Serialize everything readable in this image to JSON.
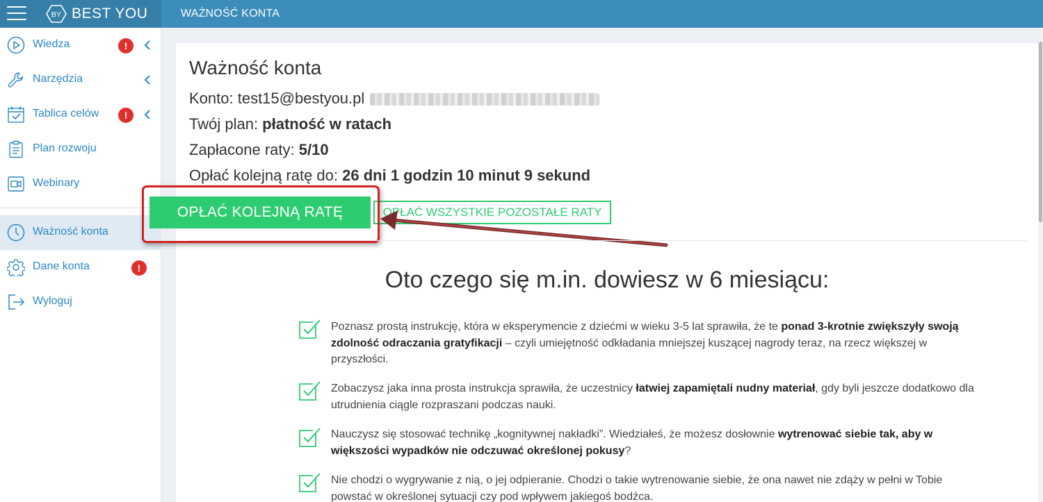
{
  "topbar": {
    "brand": "BEST YOU",
    "brand_mark": "BY",
    "page_header": "WAŻNOŚĆ KONTA"
  },
  "sidebar": {
    "items": [
      {
        "label": "Wiedza",
        "icon": "play-circle-icon",
        "badge": "!",
        "chevron": true
      },
      {
        "label": "Narzędzia",
        "icon": "wrench-icon",
        "chevron": true
      },
      {
        "label": "Tablica celów",
        "icon": "calendar-check-icon",
        "badge": "!",
        "chevron": true
      },
      {
        "label": "Plan rozwoju",
        "icon": "clipboard-icon"
      },
      {
        "label": "Webinary",
        "icon": "video-camera-icon"
      },
      {
        "label": "Ważność konta",
        "icon": "clock-icon",
        "active": true
      },
      {
        "label": "Dane konta",
        "icon": "gear-icon",
        "badge": "!"
      },
      {
        "label": "Wyloguj",
        "icon": "logout-icon"
      }
    ]
  },
  "main": {
    "title": "Ważność konta",
    "account_label": "Konto: ",
    "account_email": "test15@bestyou.pl",
    "plan_label": "Twój plan: ",
    "plan_value": "płatność w ratach",
    "paid_label": "Zapłacone raty: ",
    "paid_value": "5/10",
    "due_label": "Opłać kolejną ratę do: ",
    "due_value": "26 dni 1 godzin 10 minut 9 sekund",
    "btn_pay_next": "OPŁAĆ KOLEJNĄ RATĘ",
    "btn_pay_all": "OPŁAĆ WSZYSTKIE POZOSTAŁE RATY",
    "heading": "Oto czego się m.in. dowiesz w 6 miesiącu:",
    "features": [
      {
        "p1": "Poznasz prostą instrukcję, która w eksperymencie z dziećmi w wieku 3-5 lat sprawiła, że te ",
        "b1": "ponad 3-krotnie zwiększyły swoją zdolność odraczania gratyfikacji",
        "p2": " – czyli umiejętność odkładania mniejszej kuszącej nagrody teraz, na rzecz większej w przyszłości."
      },
      {
        "p1": "Zobaczysz jaka inna prosta instrukcja sprawiła, że uczestnicy ",
        "b1": "łatwiej zapamiętali nudny materiał",
        "p2": ", gdy byli jeszcze dodatkowo dla utrudnienia ciągle rozpraszani podczas nauki."
      },
      {
        "p1": "Nauczysz się stosować technikę „kognitywnej nakładki”. Wiedziałeś, że możesz dosłownie ",
        "b1": "wytrenować siebie tak, aby w większości wypadków nie odczuwać określonej pokusy",
        "p2": "?"
      },
      {
        "p1": "Nie chodzi o wygrywanie z nią, o jej odpieranie. Chodzi o takie wytrenowanie siebie, że ona nawet nie zdąży w pełni w Tobie powstać w określonej sytuacji czy pod wpływem jakiegoś bodźca.",
        "b1": "",
        "p2": ""
      }
    ]
  },
  "colors": {
    "topbar": "#3c8dbc",
    "topbar_dark": "#367fa9",
    "accent_green": "#2ecc71",
    "badge_red": "#e0302e",
    "link_blue": "#2a87c6",
    "annotation_red": "#d42020",
    "arrow_dark_red": "#7a2a2a"
  }
}
